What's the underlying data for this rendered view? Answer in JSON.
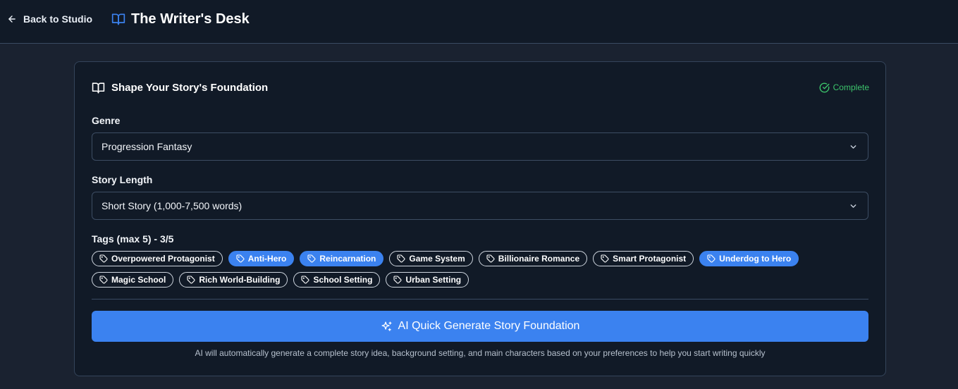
{
  "header": {
    "back_label": "Back to Studio",
    "title": "The Writer's Desk",
    "accent": "#3b82f0"
  },
  "card": {
    "title": "Shape Your Story's Foundation",
    "status": "Complete",
    "status_color": "#3cc46b"
  },
  "genre": {
    "label": "Genre",
    "value": "Progression Fantasy"
  },
  "length": {
    "label": "Story Length",
    "value": "Short Story (1,000-7,500 words)"
  },
  "tags": {
    "label": "Tags (max 5) - 3/5",
    "items": [
      {
        "label": "Overpowered Protagonist",
        "selected": false
      },
      {
        "label": "Anti-Hero",
        "selected": true
      },
      {
        "label": "Reincarnation",
        "selected": true
      },
      {
        "label": "Game System",
        "selected": false
      },
      {
        "label": "Billionaire Romance",
        "selected": false
      },
      {
        "label": "Smart Protagonist",
        "selected": false
      },
      {
        "label": "Underdog to Hero",
        "selected": true
      },
      {
        "label": "Magic School",
        "selected": false
      },
      {
        "label": "Rich World-Building",
        "selected": false
      },
      {
        "label": "School Setting",
        "selected": false
      },
      {
        "label": "Urban Setting",
        "selected": false
      }
    ]
  },
  "generate": {
    "label": "AI Quick Generate Story Foundation",
    "hint": "AI will automatically generate a complete story idea, background setting, and main characters based on your preferences to help you start writing quickly"
  }
}
